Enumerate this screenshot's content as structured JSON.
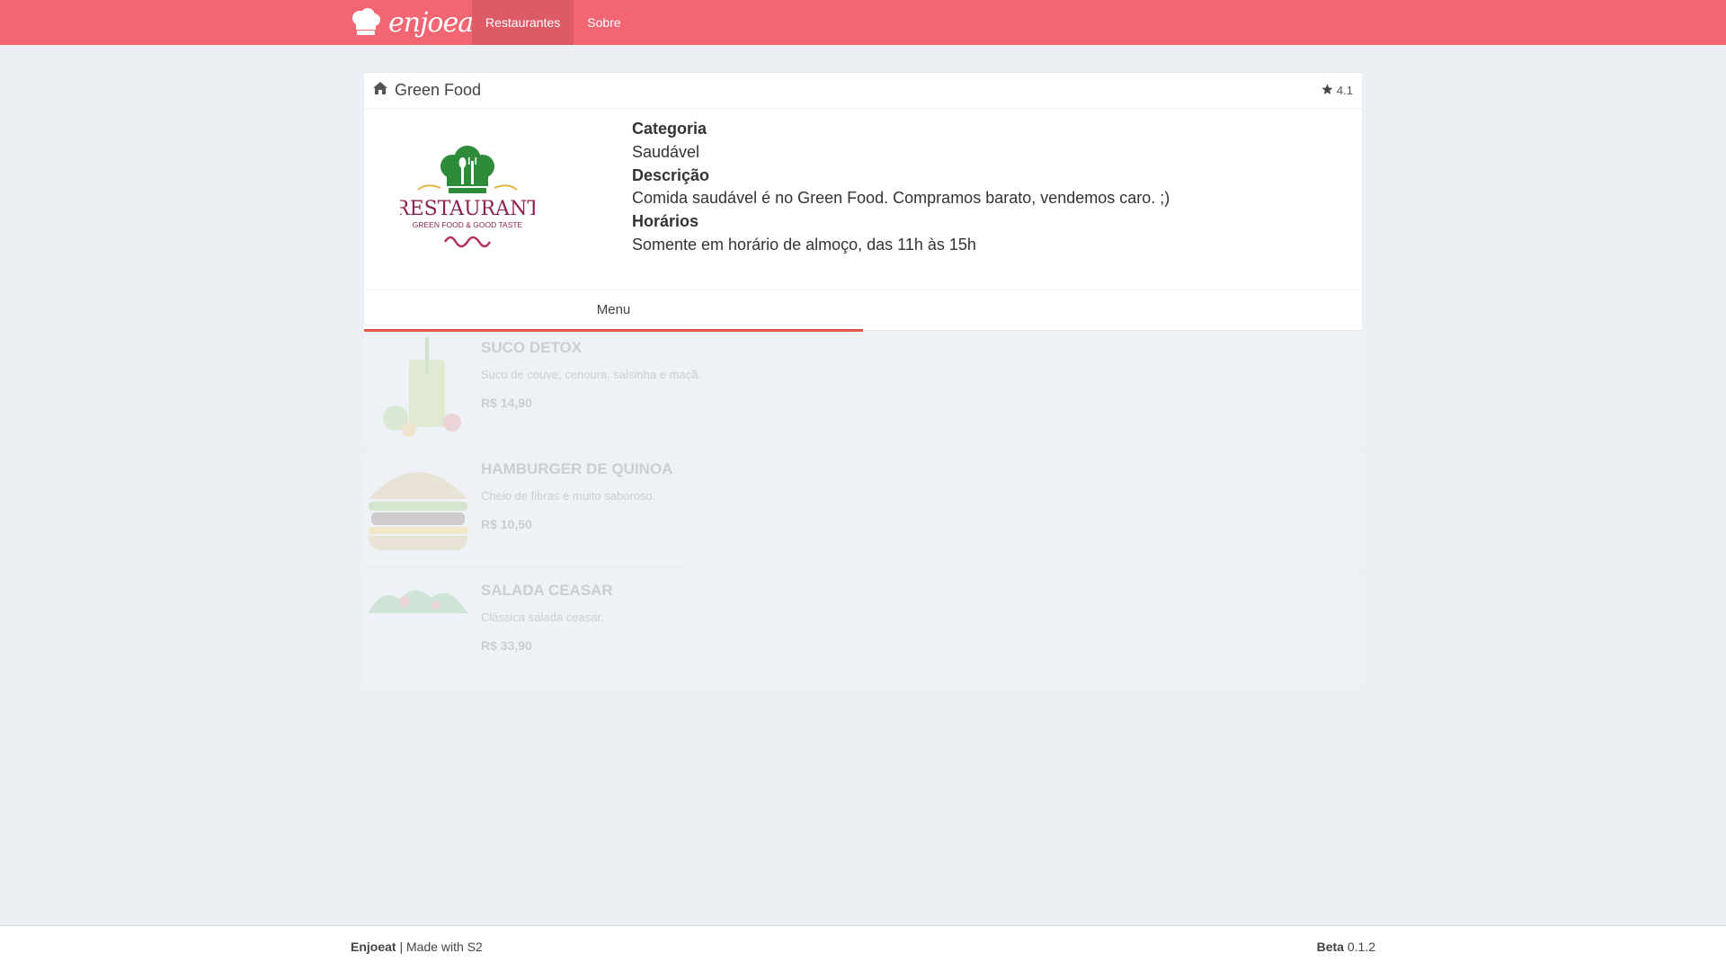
{
  "nav": {
    "brand": "enjoeat",
    "items": [
      {
        "label": "Restaurantes",
        "active": true
      },
      {
        "label": "Sobre",
        "active": false
      }
    ]
  },
  "restaurant": {
    "name": "Green Food",
    "rating": "4.1",
    "logo": {
      "title": "RESTAURANT",
      "subtitle": "GREEN FOOD & GOOD TASTE"
    },
    "category_label": "Categoria",
    "category": "Saudável",
    "description_label": "Descrição",
    "description": "Comida saudável é no Green Food. Compramos barato, vendemos caro. ;)",
    "hours_label": "Horários",
    "hours": "Somente em horário de almoço, das 11h às 15h"
  },
  "tabs": {
    "menu": "Menu"
  },
  "menu": [
    {
      "name": "SUCO DETOX",
      "description": "Suco de couve, cenoura, salsinha e maçã.",
      "price": "R$ 14,90",
      "icon": "juice-icon"
    },
    {
      "name": "HAMBURGER DE QUINOA",
      "description": "Cheio de fibras e muito saboroso.",
      "price": "R$ 10,50",
      "icon": "burger-icon"
    },
    {
      "name": "SALADA CEASAR",
      "description": "Clássica salada ceasar.",
      "price": "R$ 33,90",
      "icon": "salad-icon"
    }
  ],
  "footer": {
    "brand": "Enjoeat",
    "tagline": "| Made with S2",
    "beta_label": "Beta",
    "version": "0.1.2"
  },
  "colors": {
    "nav": "#f26572",
    "nav_active": "#dc5b67",
    "tab_underline": "#dd4b39",
    "background": "#ecf0f5"
  }
}
